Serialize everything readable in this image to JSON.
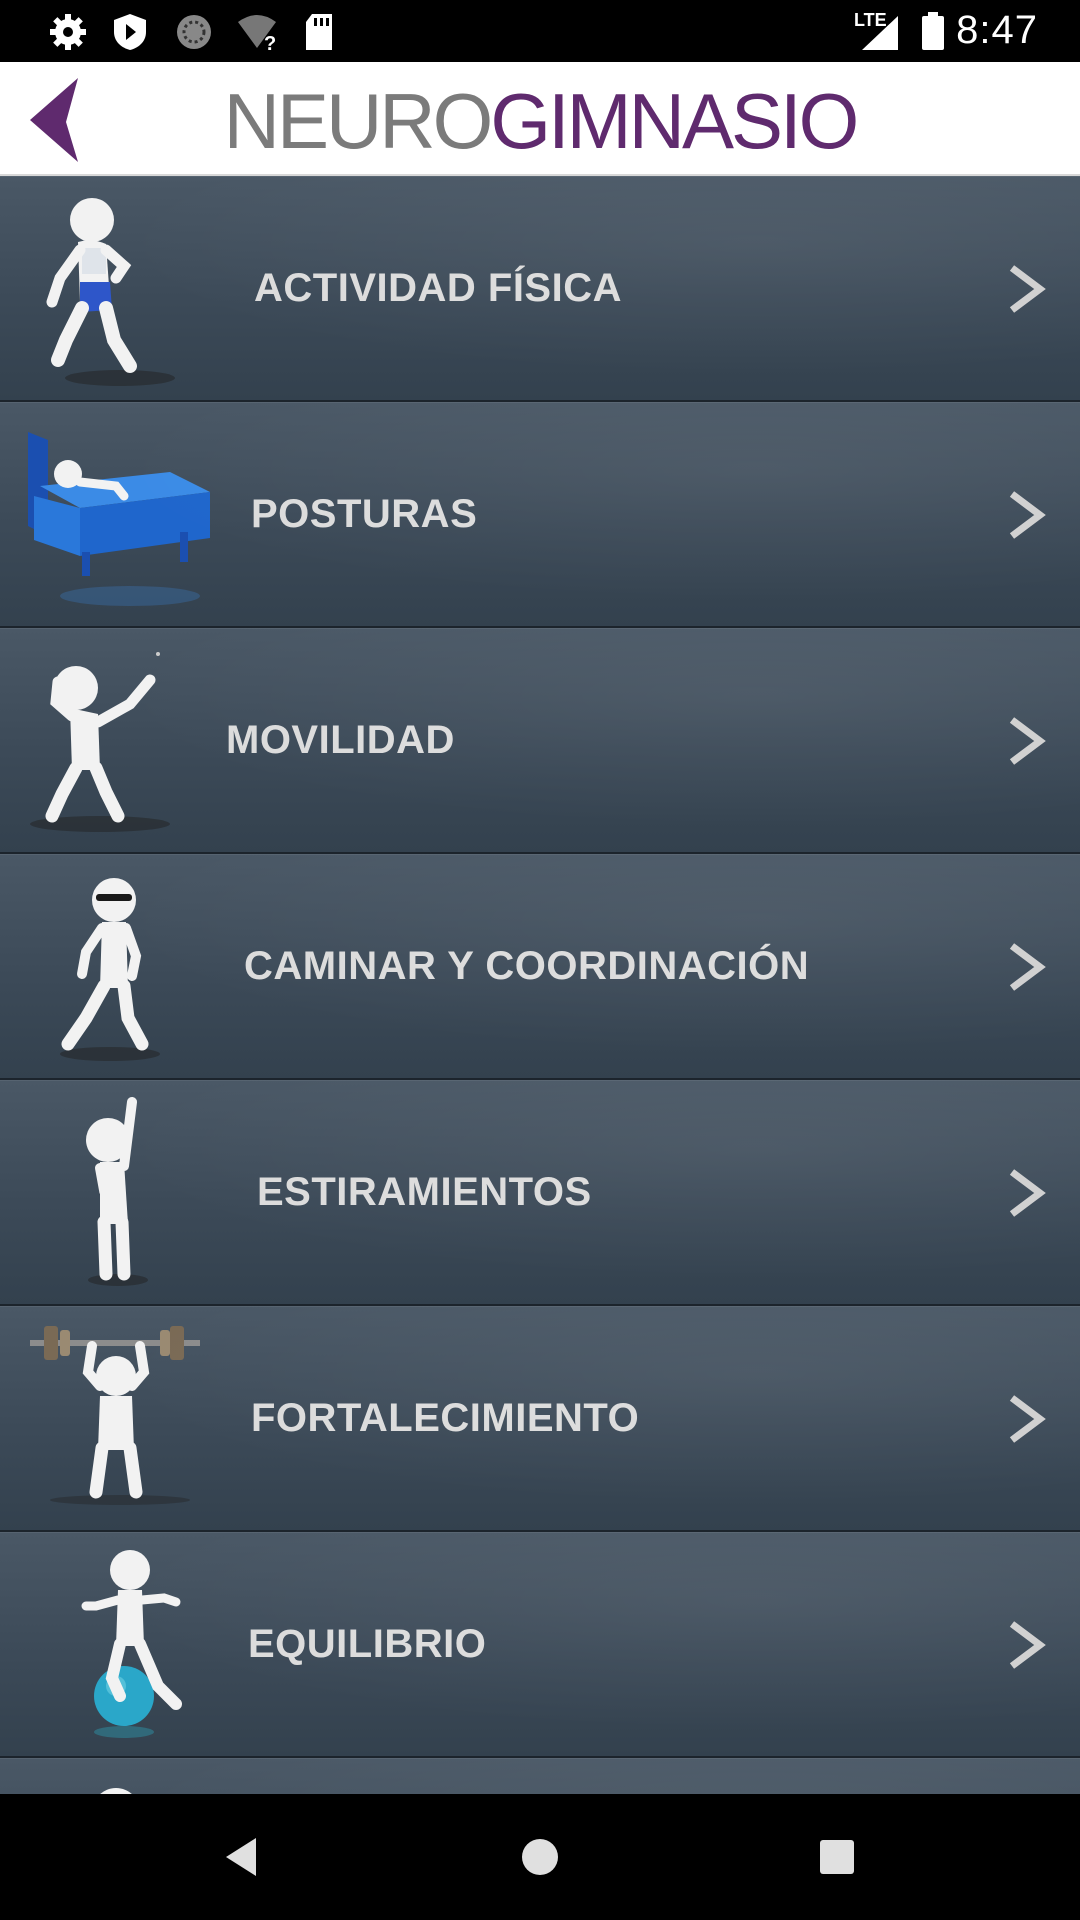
{
  "status_bar": {
    "time": "8:47",
    "network": "LTE",
    "icons": [
      "settings-icon",
      "shield-icon",
      "sync-icon",
      "wifi-unknown-icon",
      "sd-card-icon",
      "signal-icon",
      "battery-icon"
    ]
  },
  "header": {
    "title_part1": "NEURO",
    "title_part2": "GIMNASIO",
    "back_icon": "back-chevron-icon",
    "colors": {
      "title_grey": "#7b7b7b",
      "title_purple": "#5f2a6e",
      "back_purple": "#5f2a6e"
    }
  },
  "menu": {
    "items": [
      {
        "label": "ACTIVIDAD FÍSICA",
        "icon": "runner-figure-icon"
      },
      {
        "label": "POSTURAS",
        "icon": "bed-figure-icon"
      },
      {
        "label": "MOVILIDAD",
        "icon": "stretching-figure-icon"
      },
      {
        "label": "CAMINAR Y COORDINACIÓN",
        "icon": "walking-figure-icon"
      },
      {
        "label": "ESTIRAMIENTOS",
        "icon": "arm-raised-figure-icon"
      },
      {
        "label": "FORTALECIMIENTO",
        "icon": "weightlifter-figure-icon"
      },
      {
        "label": "EQUILIBRIO",
        "icon": "balance-ball-figure-icon"
      }
    ],
    "chevron_icon": "chevron-right-icon",
    "colors": {
      "item_bg": "#3c4a58",
      "label": "#dcdcdc"
    }
  },
  "nav_bar": {
    "icons": [
      "nav-back-icon",
      "nav-home-icon",
      "nav-recents-icon"
    ]
  }
}
